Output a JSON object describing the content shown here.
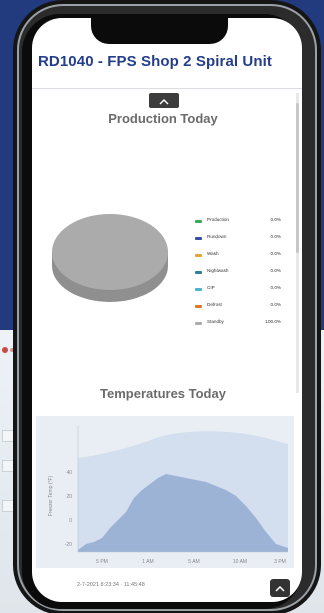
{
  "header": {
    "title": "RD1040 - FPS Shop 2 Spiral Unit"
  },
  "production": {
    "title": "Production Today",
    "legend": [
      {
        "label": "Production",
        "value": "0.0%",
        "color": "#3fa95a"
      },
      {
        "label": "Rundown",
        "value": "0.0%",
        "color": "#3a4ea8"
      },
      {
        "label": "Wash",
        "value": "0.0%",
        "color": "#e5a33a"
      },
      {
        "label": "Nightwash",
        "value": "0.0%",
        "color": "#2f7e9a"
      },
      {
        "label": "CIP",
        "value": "0.0%",
        "color": "#48b6cf"
      },
      {
        "label": "Defrost",
        "value": "0.0%",
        "color": "#e0782c"
      },
      {
        "label": "Standby",
        "value": "100.0%",
        "color": "#ababab"
      }
    ]
  },
  "temperatures": {
    "title": "Temperatures Today",
    "ylabel": "Freezer Temp (°F)",
    "yticks": [
      "40",
      "20",
      "0",
      "-20"
    ],
    "xticks": [
      "5 PM",
      "1 AM",
      "5 AM",
      "10 AM",
      "3 PM"
    ],
    "footer": "2-7-2021   8:23:34   ·   11:45:48"
  },
  "chart_data": {
    "type": "pie",
    "title": "Production Today",
    "categories": [
      "Production",
      "Rundown",
      "Wash",
      "Nightwash",
      "CIP",
      "Defrost",
      "Standby"
    ],
    "values": [
      0.0,
      0.0,
      0.0,
      0.0,
      0.0,
      0.0,
      100.0
    ]
  },
  "icons": {
    "collapse": "chevron-up-icon",
    "side_toggle": "chevron-right-icon",
    "scroll_top": "chevron-up-icon"
  }
}
